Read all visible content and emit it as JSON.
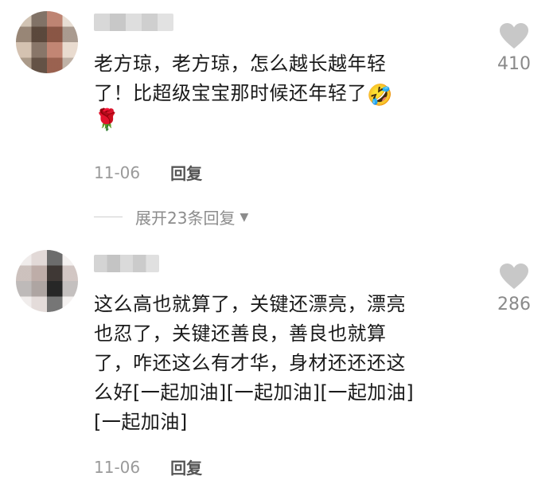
{
  "comments": [
    {
      "username": "",
      "lines": [
        "老方琼，老方琼，怎么越长越年轻",
        "了！比超级宝宝那时候还年轻了"
      ],
      "inline_emoji": "🤣",
      "trailing_emoji": "🌹",
      "date": "11-06",
      "reply_label": "回复",
      "likes": "410",
      "expand_label": "展开23条回复"
    },
    {
      "username": "",
      "lines": [
        "这么高也就算了，关键还漂亮，漂亮",
        "也忍了，关键还善良，善良也就算",
        "了，咋还这么有才华，身材还还还这",
        "么好[一起加油][一起加油][一起加油]",
        "[一起加油]"
      ],
      "date": "11-06",
      "reply_label": "回复",
      "likes": "286"
    }
  ],
  "icons": {
    "like": "heart-icon",
    "expand": "caret-down-icon"
  },
  "colors": {
    "text": "#1a1a1a",
    "meta": "#9a9a9a",
    "heart": "#c8c8c8"
  }
}
